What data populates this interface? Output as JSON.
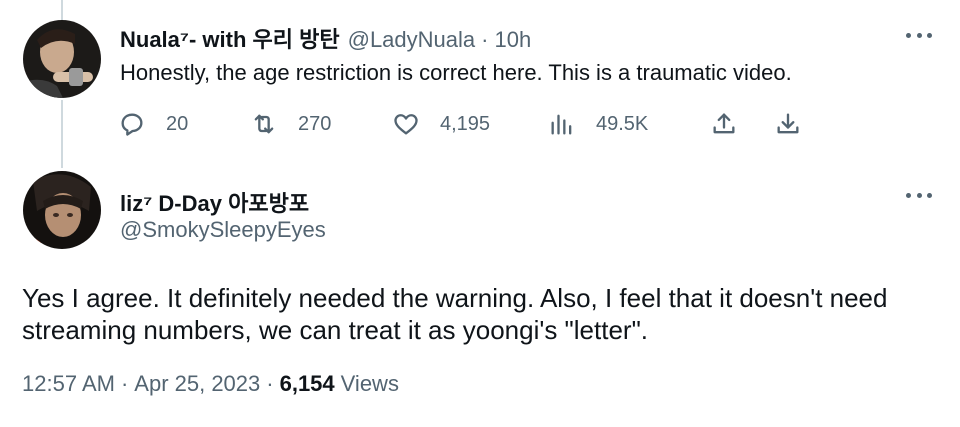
{
  "reply": {
    "display_name": "Nuala⁷- with 우리 방탄",
    "handle": "@LadyNuala",
    "separator": "·",
    "time": "10h",
    "text": "Honestly, the age restriction is correct here. This is a traumatic video.",
    "actions": {
      "replies": "20",
      "retweets": "270",
      "likes": "4,195",
      "views": "49.5K"
    }
  },
  "main": {
    "display_name": "liz⁷ D-Day 아포방포",
    "handle": "@SmokySleepyEyes",
    "text": "Yes I agree. It definitely needed the warning. Also, I feel that it doesn't need streaming numbers, we can treat it as yoongi's \"letter\".",
    "time": "12:57 AM",
    "date": "Apr 25, 2023",
    "separator1": "·",
    "separator2": "·",
    "views_count": "6,154",
    "views_label": "Views"
  },
  "icons": [
    "reply-icon",
    "retweet-icon",
    "like-icon",
    "views-icon",
    "share-icon",
    "download-icon",
    "more-icon"
  ],
  "colors": {
    "text": "#0f1419",
    "secondary": "#536471",
    "thread_line": "#cfd9de"
  }
}
